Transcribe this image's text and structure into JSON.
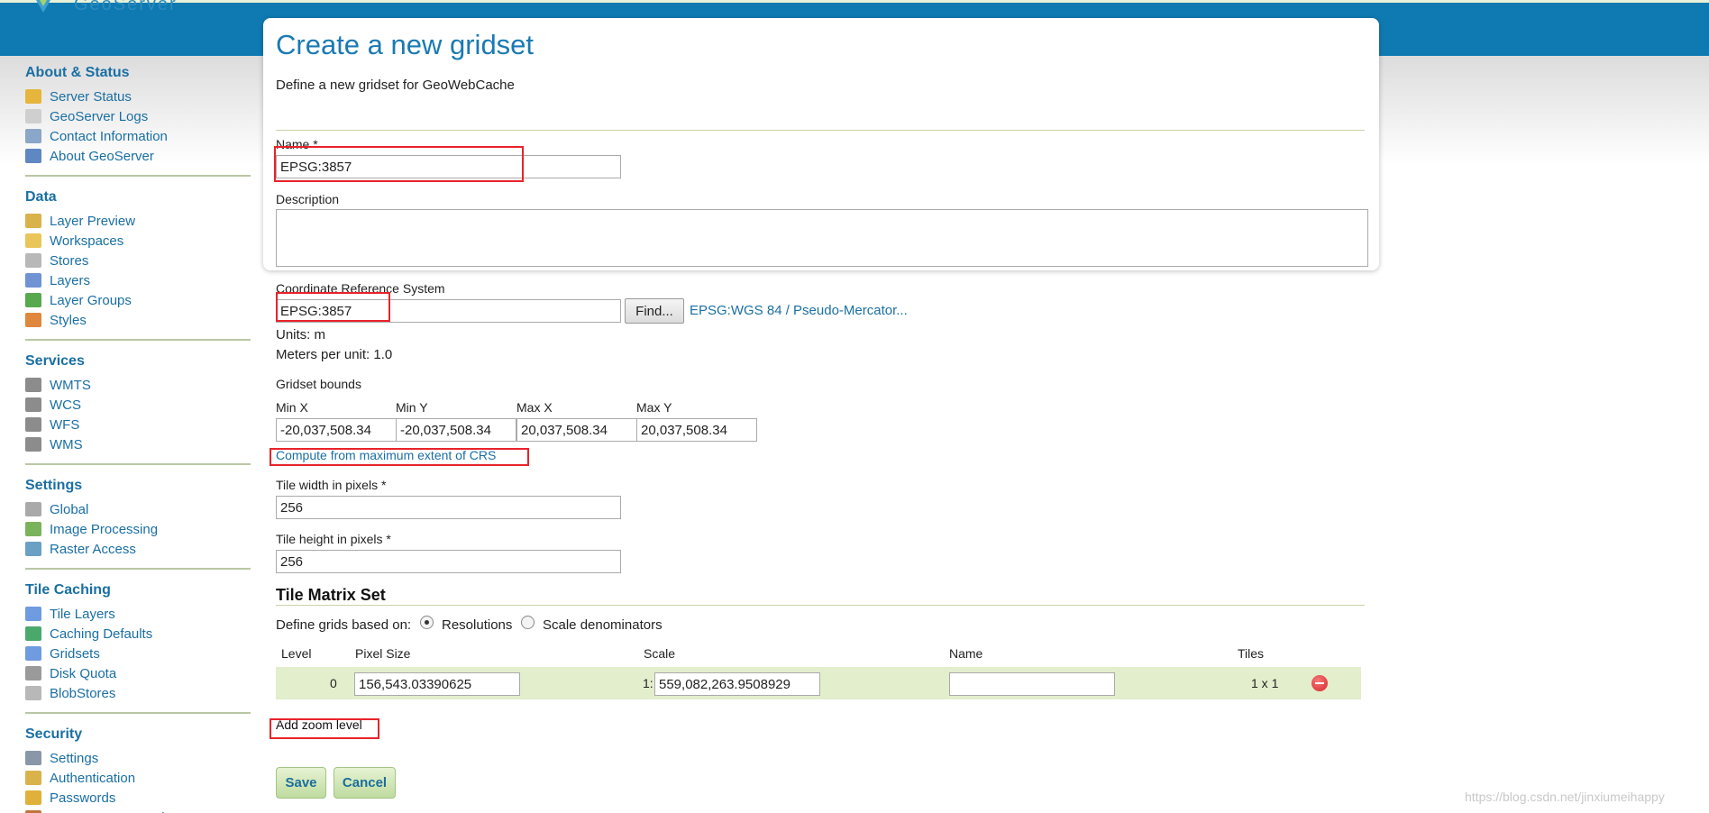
{
  "header": {
    "logo_text": "GeoServer"
  },
  "sidebar": {
    "sections": [
      {
        "heading": "About & Status",
        "items": [
          {
            "label": "Server Status",
            "icon": "warning-icon"
          },
          {
            "label": "GeoServer Logs",
            "icon": "document-icon"
          },
          {
            "label": "Contact Information",
            "icon": "contact-card-icon"
          },
          {
            "label": "About GeoServer",
            "icon": "help-icon"
          }
        ]
      },
      {
        "heading": "Data",
        "items": [
          {
            "label": "Layer Preview",
            "icon": "map-preview-icon"
          },
          {
            "label": "Workspaces",
            "icon": "folder-icon"
          },
          {
            "label": "Stores",
            "icon": "database-icon"
          },
          {
            "label": "Layers",
            "icon": "layer-icon"
          },
          {
            "label": "Layer Groups",
            "icon": "layer-group-icon"
          },
          {
            "label": "Styles",
            "icon": "palette-icon"
          }
        ]
      },
      {
        "heading": "Services",
        "items": [
          {
            "label": "WMTS",
            "icon": "service-icon"
          },
          {
            "label": "WCS",
            "icon": "service-icon"
          },
          {
            "label": "WFS",
            "icon": "service-icon"
          },
          {
            "label": "WMS",
            "icon": "service-icon"
          }
        ]
      },
      {
        "heading": "Settings",
        "items": [
          {
            "label": "Global",
            "icon": "server-icon"
          },
          {
            "label": "Image Processing",
            "icon": "image-icon"
          },
          {
            "label": "Raster Access",
            "icon": "raster-icon"
          }
        ]
      },
      {
        "heading": "Tile Caching",
        "items": [
          {
            "label": "Tile Layers",
            "icon": "grid-icon"
          },
          {
            "label": "Caching Defaults",
            "icon": "globe-icon"
          },
          {
            "label": "Gridsets",
            "icon": "grid-icon"
          },
          {
            "label": "Disk Quota",
            "icon": "disk-icon"
          },
          {
            "label": "BlobStores",
            "icon": "database-icon"
          }
        ]
      },
      {
        "heading": "Security",
        "items": [
          {
            "label": "Settings",
            "icon": "wrench-icon"
          },
          {
            "label": "Authentication",
            "icon": "shield-icon"
          },
          {
            "label": "Passwords",
            "icon": "lock-icon"
          },
          {
            "label": "Users, Groups, Roles",
            "icon": "users-icon"
          }
        ]
      }
    ]
  },
  "page": {
    "title": "Create a new gridset",
    "subtitle": "Define a new gridset for GeoWebCache"
  },
  "form": {
    "name_label": "Name *",
    "name_value": "EPSG:3857",
    "description_label": "Description",
    "description_value": "",
    "crs_label": "Coordinate Reference System",
    "crs_value": "EPSG:3857",
    "find_label": "Find...",
    "crs_link": "EPSG:WGS 84 / Pseudo-Mercator...",
    "units": "Units: m",
    "meters_per_unit": "Meters per unit: 1.0",
    "bounds_label": "Gridset bounds",
    "bounds": {
      "minx_label": "Min X",
      "miny_label": "Min Y",
      "maxx_label": "Max X",
      "maxy_label": "Max Y",
      "minx": "-20,037,508.34",
      "miny": "-20,037,508.34",
      "maxx": "20,037,508.34",
      "maxy": "20,037,508.34"
    },
    "compute_link": "Compute from maximum extent of CRS",
    "tile_width_label": "Tile width in pixels *",
    "tile_width": "256",
    "tile_height_label": "Tile height in pixels *",
    "tile_height": "256"
  },
  "tile_matrix": {
    "title": "Tile Matrix Set",
    "define_label": "Define grids based on:",
    "option_resolutions": "Resolutions",
    "option_scale": "Scale denominators",
    "columns": {
      "level": "Level",
      "pixel_size": "Pixel Size",
      "scale": "Scale",
      "name": "Name",
      "tiles": "Tiles"
    },
    "rows": [
      {
        "level": "0",
        "pixel_size": "156,543.03390625",
        "scale_prefix": "1:",
        "scale": "559,082,263.9508929",
        "name": "",
        "tiles": "1 x 1"
      }
    ],
    "add_zoom_level": "Add zoom level"
  },
  "actions": {
    "save": "Save",
    "cancel": "Cancel"
  },
  "watermark": "https://blog.csdn.net/jinxiumeihappy"
}
